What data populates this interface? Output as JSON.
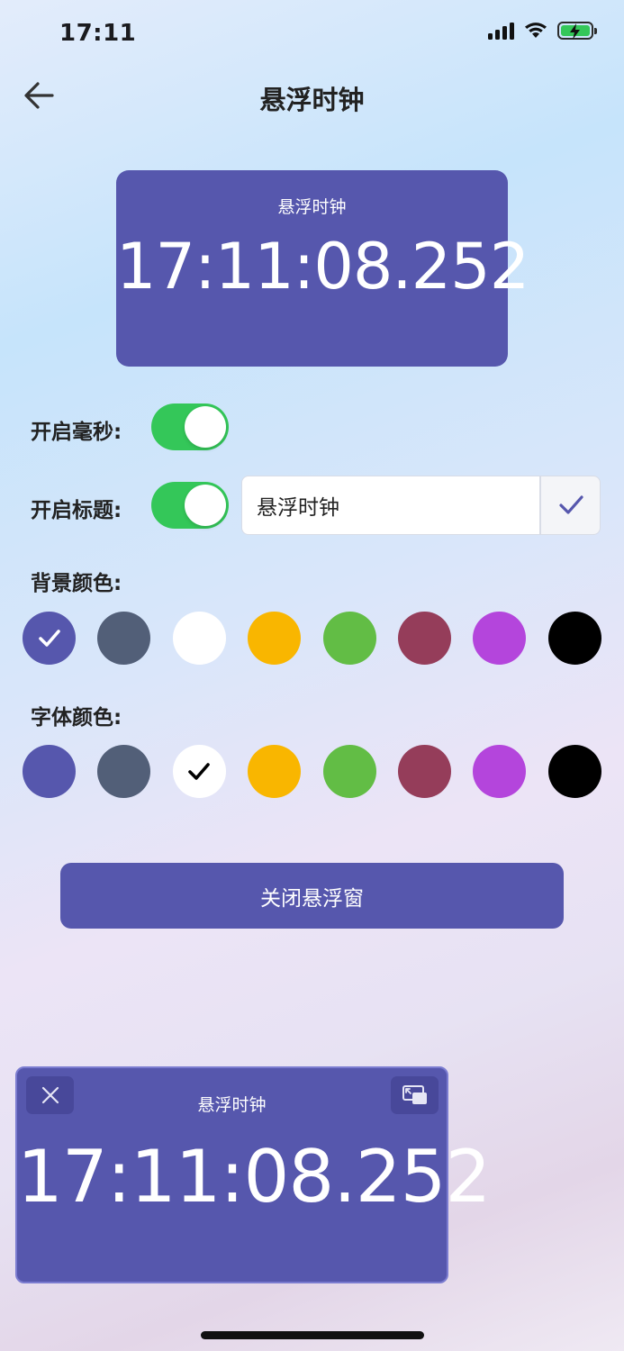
{
  "status_bar": {
    "time": "17:11"
  },
  "nav": {
    "title": "悬浮时钟"
  },
  "preview": {
    "title": "悬浮时钟",
    "time": "17:11:08.252"
  },
  "settings": {
    "ms_label": "开启毫秒:",
    "ms_enabled": true,
    "title_label": "开启标题:",
    "title_enabled": true,
    "title_value": "悬浮时钟"
  },
  "background_color": {
    "label": "背景颜色:",
    "selected_index": 0,
    "colors": [
      "#5657ad",
      "#525f78",
      "#ffffff",
      "#f9b600",
      "#62bd45",
      "#953d5a",
      "#b445dc",
      "#000000"
    ]
  },
  "font_color": {
    "label": "字体颜色:",
    "selected_index": 2,
    "colors": [
      "#5657ad",
      "#525f78",
      "#ffffff",
      "#f9b600",
      "#62bd45",
      "#953d5a",
      "#b445dc",
      "#000000"
    ]
  },
  "actions": {
    "close_float_label": "关闭悬浮窗"
  },
  "float_window": {
    "title": "悬浮时钟",
    "time": "17:11:08.252"
  },
  "icons": {
    "back": "arrow-left-icon",
    "confirm": "check-icon",
    "close": "close-icon",
    "pip": "picture-in-picture-icon"
  }
}
